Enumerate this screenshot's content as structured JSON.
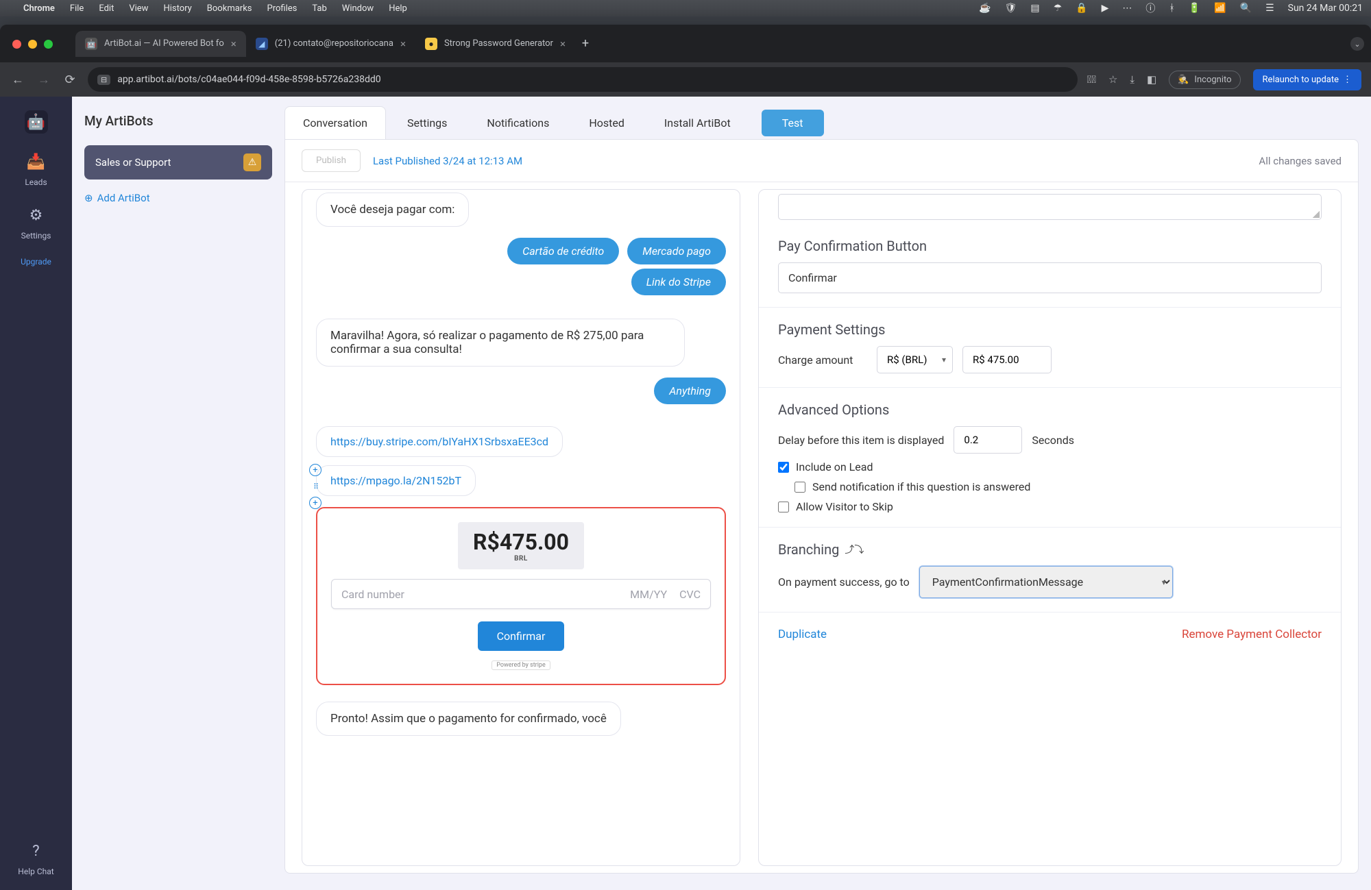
{
  "menubar": {
    "apple": "",
    "app": "Chrome",
    "items": [
      "File",
      "Edit",
      "View",
      "History",
      "Bookmarks",
      "Profiles",
      "Tab",
      "Window",
      "Help"
    ],
    "clock": "Sun 24 Mar  00:21"
  },
  "browser": {
    "tabs": [
      {
        "favicon": "🤖",
        "title": "ArtiBot.ai — AI Powered Bot fo",
        "active": true
      },
      {
        "favicon": "✉",
        "title": "(21) contato@repositoriocana",
        "active": false
      },
      {
        "favicon": "🔑",
        "title": "Strong Password Generator",
        "active": false
      }
    ],
    "url": "app.artibot.ai/bots/c04ae044-f09d-458e-8598-b5726a238dd0",
    "incognito": "Incognito",
    "relaunch": "Relaunch to update"
  },
  "rail": {
    "bots": "",
    "leads": "Leads",
    "settings": "Settings",
    "upgrade": "Upgrade",
    "help": "Help Chat"
  },
  "leftcol": {
    "heading": "My ArtiBots",
    "project": "Sales or Support",
    "add": "Add ArtiBot"
  },
  "tabs": {
    "conversation": "Conversation",
    "settings": "Settings",
    "notifications": "Notifications",
    "hosted": "Hosted",
    "install": "Install ArtiBot",
    "test": "Test"
  },
  "panelHeader": {
    "publish": "Publish",
    "lastPublished": "Last Published 3/24 at 12:13 AM",
    "saved": "All changes saved"
  },
  "conv": {
    "q": "Você deseja pagar com:",
    "chips": [
      "Cartão de crédito",
      "Mercado pago",
      "Link do Stripe"
    ],
    "confirmMsg": "Maravilha! Agora, só realizar o pagamento de R$ 275,00 para confirmar a sua consulta!",
    "anything": "Anything",
    "stripeLink": "https://buy.stripe.com/bIYaHX1SrbsxaEE3cd",
    "mpagoLink": "https://mpago.la/2N152bT",
    "price": "R$475.00",
    "currency": "BRL",
    "cardPlaceholder": "Card number",
    "mm": "MM/YY",
    "cvc": "CVC",
    "confirmBtn": "Confirmar",
    "powered": "Powered by stripe",
    "finalMsg": "Pronto! Assim que o pagamento for confirmado, você"
  },
  "settings": {
    "payConfirmTitle": "Pay Confirmation Button",
    "payConfirmValue": "Confirmar",
    "paymentTitle": "Payment Settings",
    "chargeLabel": "Charge amount",
    "currency": "R$ (BRL)",
    "amount": "R$ 475.00",
    "advancedTitle": "Advanced Options",
    "delayLabel": "Delay before this item is displayed",
    "delayValue": "0.2",
    "seconds": "Seconds",
    "includeOnLead": "Include on Lead",
    "sendNotif": "Send notification if this question is answered",
    "allowSkip": "Allow Visitor to Skip",
    "branchTitle": "Branching",
    "onSuccess": "On payment success, go to",
    "branchTarget": "PaymentConfirmationMessage",
    "duplicate": "Duplicate",
    "remove": "Remove Payment Collector"
  }
}
